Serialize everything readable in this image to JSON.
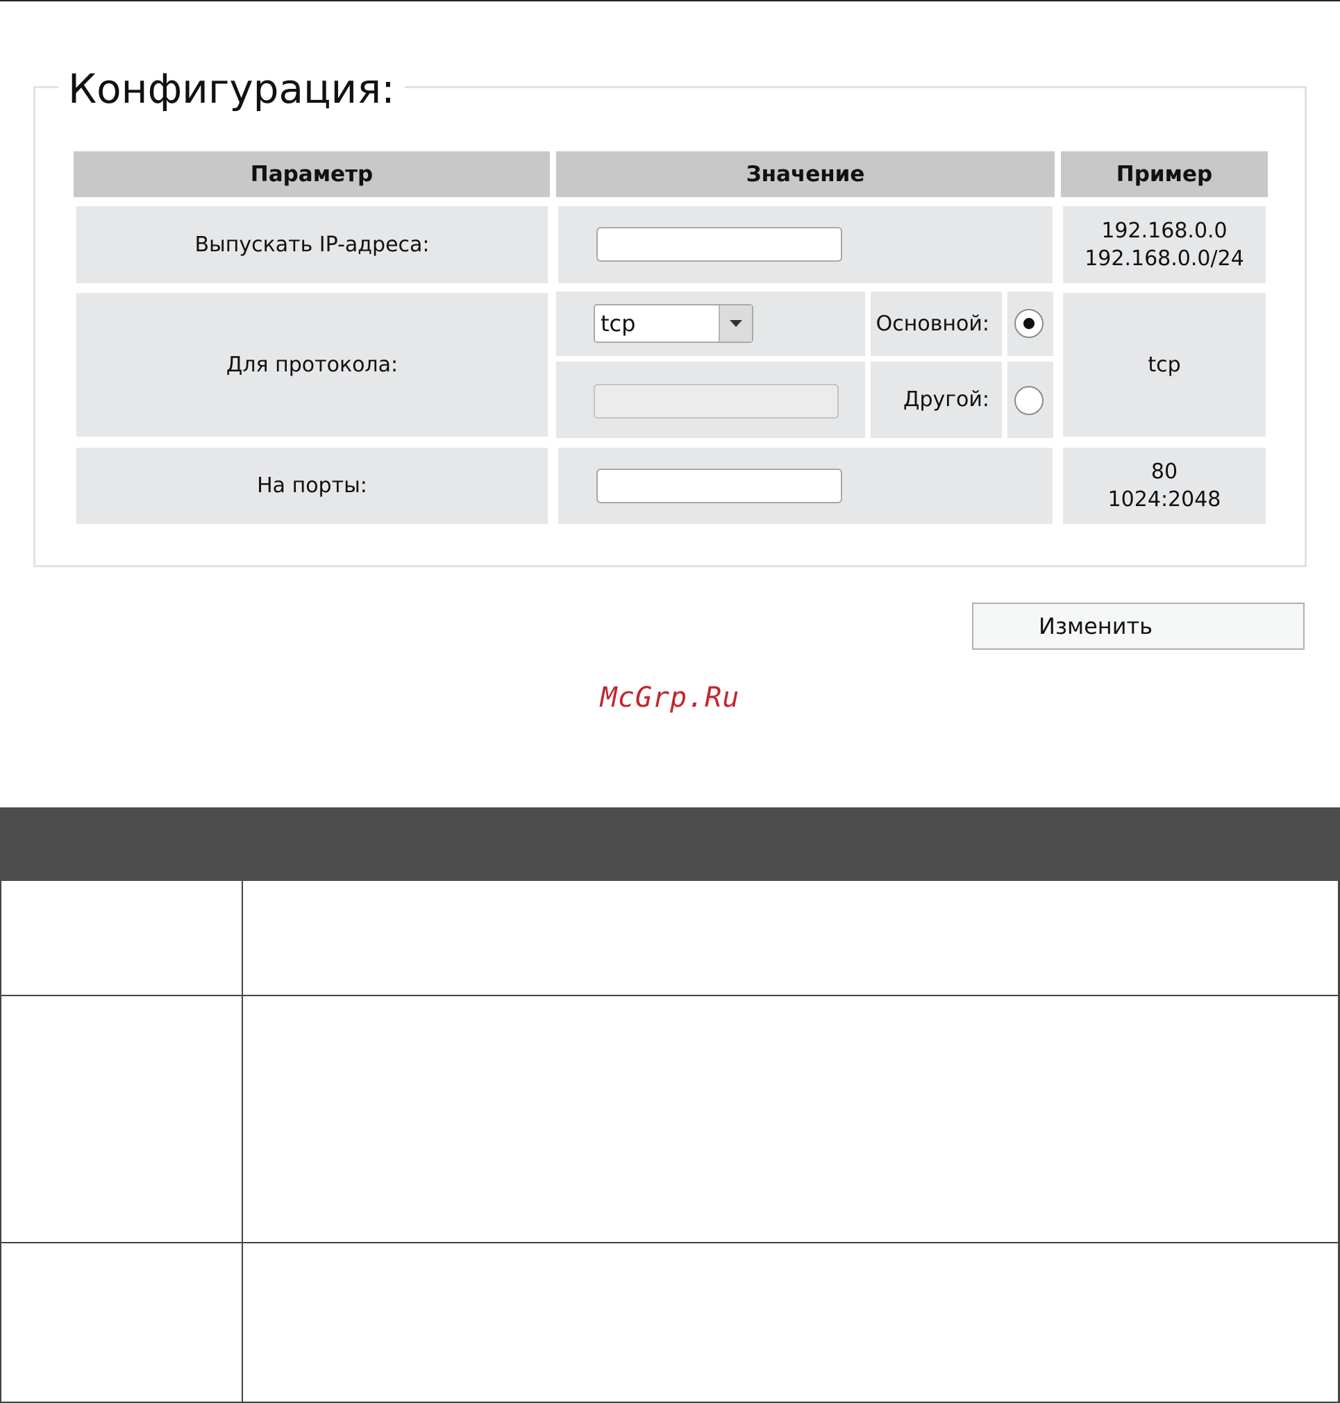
{
  "section": {
    "title": "Конфигурация:"
  },
  "table": {
    "headers": {
      "param": "Параметр",
      "value": "Значение",
      "example": "Пример"
    },
    "rows": {
      "ip": {
        "label": "Выпускать IP-адреса:",
        "value": "",
        "example_line1": "192.168.0.0",
        "example_line2": "192.168.0.0/24"
      },
      "protocol": {
        "label": "Для протокола:",
        "select_value": "tcp",
        "primary_label": "Основной:",
        "other_label": "Другой:",
        "other_value": "",
        "selected_option": "primary",
        "example": "tcp"
      },
      "ports": {
        "label": "На порты:",
        "value": "",
        "example_line1": "80",
        "example_line2": "1024:2048"
      }
    }
  },
  "actions": {
    "change_label": "Изменить"
  },
  "watermark": "McGrp.Ru"
}
